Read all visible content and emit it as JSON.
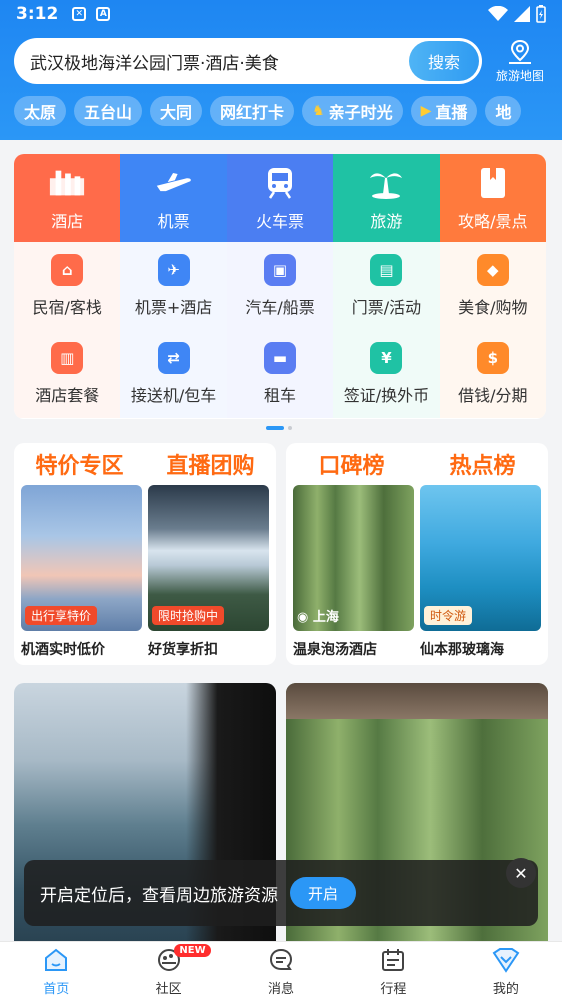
{
  "status_bar": {
    "time": "3:12",
    "icon_a": "A"
  },
  "search": {
    "text": "武汉极地海洋公园门票·酒店·美食",
    "button": "搜索"
  },
  "map_button": {
    "label": "旅游地图"
  },
  "chips": [
    {
      "label": "太原",
      "icon": ""
    },
    {
      "label": "五台山",
      "icon": ""
    },
    {
      "label": "大同",
      "icon": ""
    },
    {
      "label": "网红打卡",
      "icon": ""
    },
    {
      "label": "亲子时光",
      "icon": "horse-icon"
    },
    {
      "label": "直播",
      "icon": "live-icon"
    },
    {
      "label": "地",
      "icon": ""
    }
  ],
  "main_categories": [
    {
      "label": "酒店",
      "color": "#ff6b4a",
      "icon": "hotel-icon"
    },
    {
      "label": "机票",
      "color": "#3f86f5",
      "icon": "plane-icon"
    },
    {
      "label": "火车票",
      "color": "#4b7ef2",
      "icon": "train-icon"
    },
    {
      "label": "旅游",
      "color": "#1fc2a4",
      "icon": "palm-icon"
    },
    {
      "label": "攻略/景点",
      "color": "#ff7a3d",
      "icon": "book-icon"
    }
  ],
  "sub_rows": [
    [
      {
        "label": "民宿/客栈",
        "color": "#ff6b4a",
        "icon": "house-icon"
      },
      {
        "label": "机票+酒店",
        "color": "#3f86f5",
        "icon": "plane-hotel-icon"
      },
      {
        "label": "汽车/船票",
        "color": "#5a7df2",
        "icon": "bus-icon"
      },
      {
        "label": "门票/活动",
        "color": "#1fc2a4",
        "icon": "ticket-icon"
      },
      {
        "label": "美食/购物",
        "color": "#ff8a2a",
        "icon": "bag-icon"
      }
    ],
    [
      {
        "label": "酒店套餐",
        "color": "#ff6b4a",
        "icon": "hotel-package-icon"
      },
      {
        "label": "接送机/包车",
        "color": "#3f86f5",
        "icon": "transfer-icon"
      },
      {
        "label": "租车",
        "color": "#5a7df2",
        "icon": "car-icon"
      },
      {
        "label": "签证/换外币",
        "color": "#1fc2a4",
        "icon": "visa-icon"
      },
      {
        "label": "借钱/分期",
        "color": "#ff8a2a",
        "icon": "money-bag-icon"
      }
    ]
  ],
  "promos": {
    "left": {
      "titles": [
        "特价专区",
        "直播团购"
      ],
      "items": [
        {
          "badge": "出行享特价",
          "caption": "机酒实时低价"
        },
        {
          "badge": "限时抢购中",
          "caption": "好货享折扣"
        }
      ]
    },
    "right": {
      "titles": [
        "口碑榜",
        "热点榜"
      ],
      "items": [
        {
          "badge": "上海",
          "caption": "温泉泡汤酒店"
        },
        {
          "badge": "时令游",
          "caption": "仙本那玻璃海"
        }
      ]
    }
  },
  "toast": {
    "text": "开启定位后，查看周边旅游资源",
    "button": "开启"
  },
  "bottom_nav": [
    {
      "label": "首页",
      "icon": "home-icon",
      "active": true
    },
    {
      "label": "社区",
      "icon": "community-icon",
      "badge": "NEW"
    },
    {
      "label": "消息",
      "icon": "message-icon"
    },
    {
      "label": "行程",
      "icon": "itinerary-icon"
    },
    {
      "label": "我的",
      "icon": "profile-icon"
    }
  ],
  "colors": {
    "brand_blue": "#2b97f6",
    "promo_orange": "#ff6a12"
  }
}
